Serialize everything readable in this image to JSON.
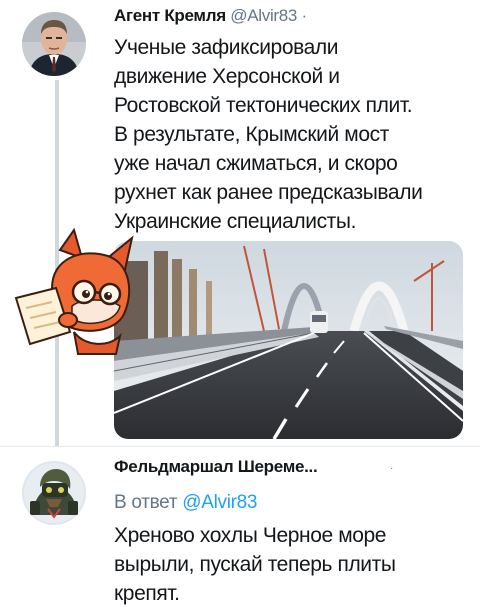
{
  "tweets": [
    {
      "author_name": "Агент Кремля",
      "handle": "@Alvir83",
      "separator": "·",
      "text_lines": [
        "Ученые зафиксировали",
        "движение Херсонской и",
        "Ростовской тектонических плит.",
        "В результате, Крымский мост",
        "уже начал сжиматься, и скоро",
        "рухнет как ранее предсказывали",
        "Украинские специалисты."
      ],
      "media": "bridge-road-photo"
    },
    {
      "author_name": "Фельдмаршал Шереме...",
      "dot": "·",
      "reply_prefix": "В ответ",
      "reply_handle": "@Alvir83",
      "text_lines": [
        "Хреново хохлы Черное море",
        "вырыли, пускай теперь плиты",
        "крепят."
      ]
    }
  ],
  "icons": {
    "sticker": "fox-reading-sticker",
    "avatar1": "man-in-suit-avatar",
    "avatar2": "armored-bear-avatar"
  },
  "colors": {
    "handle": "#657786",
    "link": "#1da1f2",
    "thread_line": "#cfd9de"
  }
}
